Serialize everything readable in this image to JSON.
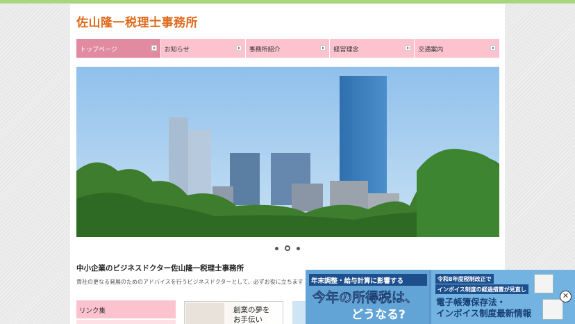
{
  "site": {
    "title": "佐山隆一税理士事務所"
  },
  "gnav": {
    "items": [
      {
        "label": "トップページ",
        "active": true
      },
      {
        "label": "お知らせ",
        "active": false
      },
      {
        "label": "事務所紹介",
        "active": false
      },
      {
        "label": "経営理念",
        "active": false
      },
      {
        "label": "交通案内",
        "active": false
      }
    ]
  },
  "slider": {
    "dots": 3,
    "active_dot": 2
  },
  "main": {
    "heading": "中小企業のビジネスドクター佐山隆一税理士事務所",
    "intro": "貴社の更なる発展のためのアドバイスを行うビジネスドクターとして、必ずお役に立ちます"
  },
  "sidebar": {
    "links_title": "リンク集"
  },
  "banner": {
    "line1": "創業の夢を",
    "line2": "お手伝い"
  },
  "ad": {
    "left_top": "年末調整・給与計算に影響する",
    "left_big": "今年の所得税は、",
    "left_big2": "どうなる?",
    "right_tag1": "令和8年度税制改正で",
    "right_tag2": "インボイス制度の経過措置が見直し",
    "right_line1": "電子帳簿保存法・",
    "right_line2": "インボイス制度最新情報",
    "close_symbol": "✕"
  },
  "colors": {
    "accent_orange": "#e06a1b",
    "nav_pink": "#fcc3ce",
    "nav_active": "#e28aa0",
    "top_green": "#a8d67a"
  }
}
